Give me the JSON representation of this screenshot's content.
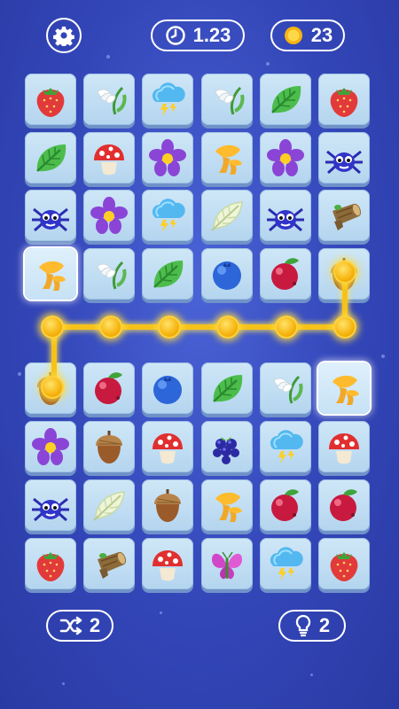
{
  "hud": {
    "timer": "1.23",
    "coins": "23",
    "shuffle_count": "2",
    "hint_count": "2",
    "icons": {
      "settings": "gear-icon",
      "timer": "clock-icon",
      "coins": "coin-icon",
      "shuffle": "shuffle-icon",
      "hint": "lightbulb-icon"
    }
  },
  "board": {
    "columns": 6,
    "rows": [
      [
        "strawberry",
        "snowdrop",
        "storm-cloud",
        "snowdrop",
        "leaf",
        "strawberry"
      ],
      [
        "leaf",
        "mushroom",
        "purple-flower",
        "chanterelle",
        "purple-flower",
        "spider"
      ],
      [
        "spider",
        "purple-flower",
        "storm-cloud",
        "feather",
        "spider",
        "tree-stump"
      ],
      [
        "chanterelle",
        "snowdrop",
        "leaf",
        "blueberry",
        "cranberry",
        "acorn"
      ],
      [
        null,
        null,
        null,
        null,
        null,
        null
      ],
      [
        "acorn",
        "cranberry",
        "blueberry",
        "leaf",
        "snowdrop",
        "chanterelle"
      ],
      [
        "purple-flower",
        "acorn",
        "mushroom",
        "blackberry",
        "storm-cloud",
        "mushroom"
      ],
      [
        "spider",
        "feather",
        "acorn",
        "chanterelle",
        "cranberry",
        "cranberry"
      ],
      [
        "strawberry",
        "tree-stump",
        "mushroom",
        "butterfly",
        "storm-cloud",
        "strawberry"
      ]
    ],
    "selected": [
      [
        3,
        0
      ],
      [
        5,
        5
      ]
    ]
  },
  "colors": {
    "background": "#3346b8",
    "tile": "#c2def3",
    "path": "#f6c21a"
  }
}
